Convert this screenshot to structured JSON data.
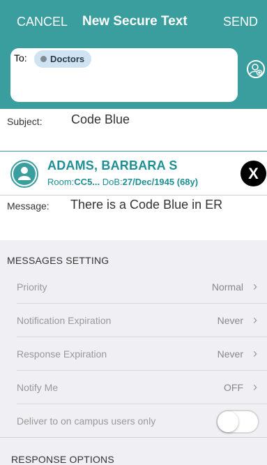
{
  "nav": {
    "cancel_label": "CANCEL",
    "title": "New Secure Text",
    "send_label": "SEND"
  },
  "recipients": {
    "to_label": "To:",
    "chips": [
      "Doctors"
    ]
  },
  "subject": {
    "label": "Subject:",
    "value": "Code Blue"
  },
  "patient": {
    "name": "ADAMS, BARBARA  S",
    "room_label": "Room:",
    "room_value": "CC5...",
    "dob_label": "DoB:",
    "dob_value": "27/Dec/1945 (68y)",
    "close_label": "X"
  },
  "message": {
    "label": "Message:",
    "value": "There is a Code Blue in ER"
  },
  "messages_setting": {
    "header": "MESSAGES SETTING",
    "items": [
      {
        "name": "Priority",
        "value": "Normal"
      },
      {
        "name": "Notification Expiration",
        "value": "Never"
      },
      {
        "name": "Response Expiration",
        "value": "Never"
      },
      {
        "name": "Notify Me",
        "value": "OFF"
      }
    ],
    "campus_only_label": "Deliver to on campus users only",
    "campus_only_on": false
  },
  "response_options": {
    "header": "RESPONSE OPTIONS"
  },
  "colors": {
    "header_bg": "#3a9e9e",
    "accent_text": "#1e8f93",
    "chip_bg": "#cfe3f3"
  }
}
